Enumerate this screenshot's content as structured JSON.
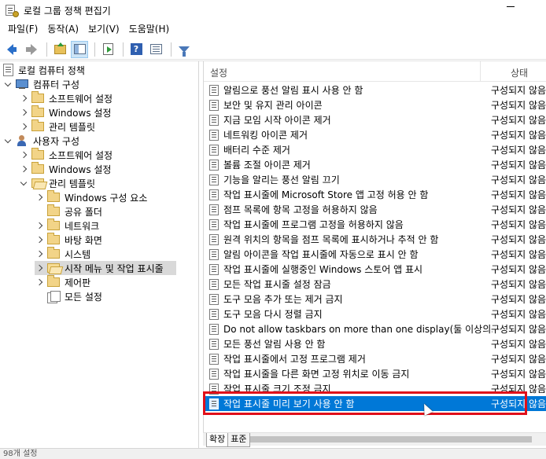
{
  "window": {
    "title": "로컬 그룹 정책 편집기"
  },
  "menu": [
    "파일(F)",
    "동작(A)",
    "보기(V)",
    "도움말(H)"
  ],
  "toolbar": {
    "buttons": [
      "back-icon",
      "forward-icon",
      "up-folder-icon",
      "show-hide-tree-icon",
      "export-list-icon",
      "help-icon",
      "properties-icon",
      "filter-icon"
    ]
  },
  "tree": [
    {
      "label": "로컬 컴퓨터 정책",
      "icon": "document-icon",
      "expander": "none"
    },
    {
      "label": "컴퓨터 구성",
      "icon": "computer-icon",
      "expander": "expanded"
    },
    {
      "label": "소프트웨어 설정",
      "icon": "folder-icon",
      "expander": "collapsed"
    },
    {
      "label": "Windows 설정",
      "icon": "folder-icon",
      "expander": "collapsed"
    },
    {
      "label": "관리 템플릿",
      "icon": "folder-icon",
      "expander": "collapsed"
    },
    {
      "label": "사용자 구성",
      "icon": "user-icon",
      "expander": "expanded"
    },
    {
      "label": "소프트웨어 설정",
      "icon": "folder-icon",
      "expander": "collapsed"
    },
    {
      "label": "Windows 설정",
      "icon": "folder-icon",
      "expander": "collapsed"
    },
    {
      "label": "관리 템플릿",
      "icon": "folder-icon",
      "expander": "expanded"
    },
    {
      "label": "Windows 구성 요소",
      "icon": "folder-icon",
      "expander": "collapsed"
    },
    {
      "label": "공유 폴더",
      "icon": "folder-icon",
      "expander": "none"
    },
    {
      "label": "네트워크",
      "icon": "folder-icon",
      "expander": "collapsed"
    },
    {
      "label": "바탕 화면",
      "icon": "folder-icon",
      "expander": "collapsed"
    },
    {
      "label": "시스템",
      "icon": "folder-icon",
      "expander": "collapsed"
    },
    {
      "label": "시작 메뉴 및 작업 표시줄",
      "icon": "folder-open-icon",
      "expander": "collapsed",
      "selected": true
    },
    {
      "label": "제어판",
      "icon": "folder-icon",
      "expander": "collapsed"
    },
    {
      "label": "모든 설정",
      "icon": "all-settings-icon",
      "expander": "none"
    }
  ],
  "list": {
    "header": {
      "setting": "설정",
      "state": "상태"
    },
    "rows": [
      {
        "name": "알림으로 풍선 알림 표시 사용 안 함",
        "state": "구성되지 않음"
      },
      {
        "name": "보안 및 유지 관리 아이콘",
        "state": "구성되지 않음"
      },
      {
        "name": "지금 모임 시작 아이콘 제거",
        "state": "구성되지 않음"
      },
      {
        "name": "네트워킹 아이콘 제거",
        "state": "구성되지 않음"
      },
      {
        "name": "배터리 수준 제거",
        "state": "구성되지 않음"
      },
      {
        "name": "볼륨 조절 아이콘 제거",
        "state": "구성되지 않음"
      },
      {
        "name": "기능을 알리는 풍선 알림 끄기",
        "state": "구성되지 않음"
      },
      {
        "name": "작업 표시줄에 Microsoft Store 앱 고정 허용 안 함",
        "state": "구성되지 않음"
      },
      {
        "name": "점프 목록에 항목 고정을 허용하지 않음",
        "state": "구성되지 않음"
      },
      {
        "name": "작업 표시줄에 프로그램 고정을 허용하지 않음",
        "state": "구성되지 않음"
      },
      {
        "name": "원격 위치의 항목을 점프 목록에 표시하거나 추적 안 함",
        "state": "구성되지 않음"
      },
      {
        "name": "알림 아이콘을 작업 표시줄에 자동으로 표시 안 함",
        "state": "구성되지 않음"
      },
      {
        "name": "작업 표시줄에 실행중인 Windows 스토어 앱 표시",
        "state": "구성되지 않음"
      },
      {
        "name": "모든 작업 표시줄 설정 잠금",
        "state": "구성되지 않음"
      },
      {
        "name": "도구 모음 추가 또는 제거 금지",
        "state": "구성되지 않음"
      },
      {
        "name": "도구 모음 다시 정렬 금지",
        "state": "구성되지 않음"
      },
      {
        "name": "Do not allow taskbars on more than one display(둘 이상의...",
        "state": "구성되지 않음"
      },
      {
        "name": "모든 풍선 알림 사용 안 함",
        "state": "구성되지 않음"
      },
      {
        "name": "작업 표시줄에서 고정 프로그램 제거",
        "state": "구성되지 않음"
      },
      {
        "name": "작업 표시줄을 다른 화면 고정 위치로 이동 금지",
        "state": "구성되지 않음"
      },
      {
        "name": "작업 표시줄 크기 조정 금지",
        "state": "구성되지 않음"
      },
      {
        "name": "작업 표시줄 미리 보기 사용 안 함",
        "state": "구성되지 않음",
        "selected": true
      }
    ]
  },
  "tabs": [
    "확장",
    "표준"
  ],
  "status": {
    "text": "98개 설정"
  },
  "colors": {
    "selection": "#0078d7",
    "highlight_box": "#e0101a",
    "tree_selected": "#d9d9d9"
  }
}
